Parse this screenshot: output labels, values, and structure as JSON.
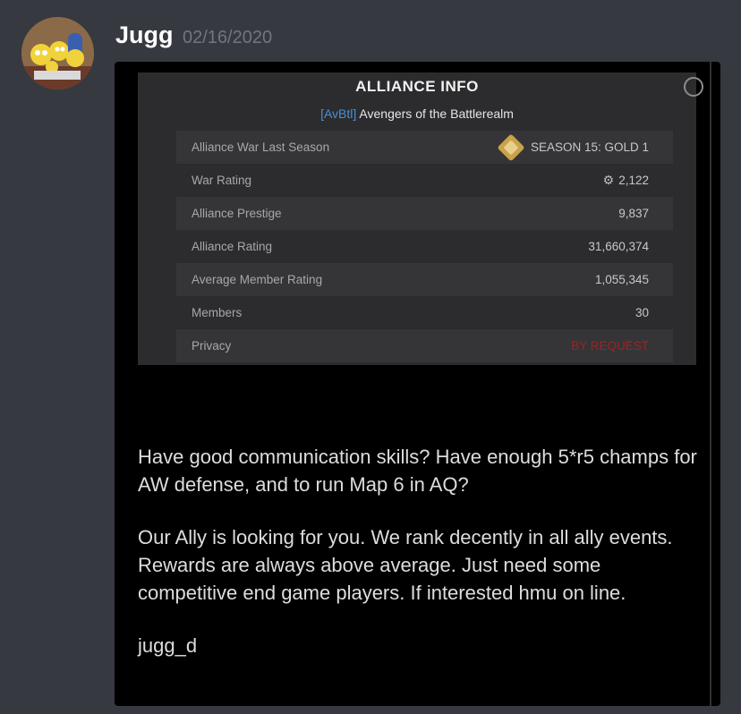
{
  "message": {
    "username": "Jugg",
    "timestamp": "02/16/2020",
    "avatar_icon": "simpsons-family-avatar"
  },
  "alliance_info": {
    "title": "ALLIANCE INFO",
    "tag": "[AvBtl]",
    "name": "Avengers of the Battlerealm",
    "rows": [
      {
        "label": "Alliance War Last Season",
        "value": "SEASON 15: GOLD 1",
        "icon": "gold-rank-badge-icon"
      },
      {
        "label": "War Rating",
        "value": "2,122",
        "icon": "war-rating-icon"
      },
      {
        "label": "Alliance Prestige",
        "value": "9,837"
      },
      {
        "label": "Alliance Rating",
        "value": "31,660,374"
      },
      {
        "label": "Average Member Rating",
        "value": "1,055,345"
      },
      {
        "label": "Members",
        "value": "30"
      },
      {
        "label": "Privacy",
        "value": "BY REQUEST",
        "color": "#a02222"
      }
    ]
  },
  "post": {
    "paragraph1": "Have good communication skills? Have enough 5*r5 champs for AW defense, and to run Map 6 in AQ?",
    "paragraph2": "Our Ally is looking for you. We rank decently in all ally events. Rewards are always above average. Just need some competitive end game players. If interested hmu on line.",
    "signature": "jugg_d"
  }
}
